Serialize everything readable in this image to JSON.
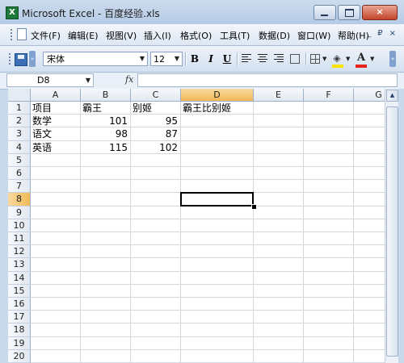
{
  "window": {
    "title": "Microsoft Excel - 百度经验.xls",
    "app_icon": "X",
    "controls": {
      "minimize": "minimize-icon",
      "maximize": "maximize-icon",
      "close": "×"
    }
  },
  "menu": {
    "items": [
      "文件(F)",
      "编辑(E)",
      "视图(V)",
      "插入(I)",
      "格式(O)",
      "工具(T)",
      "数据(D)",
      "窗口(W)",
      "帮助(H)"
    ],
    "doc_controls": [
      "_",
      "₽",
      "×"
    ]
  },
  "toolbar": {
    "font_name": "宋体",
    "font_size": "12",
    "bold": "B",
    "italic": "I",
    "underline": "U",
    "font_color_letter": "A",
    "fill_color": "#f7e200",
    "font_color": "#e8221c"
  },
  "formula_bar": {
    "name_box": "D8",
    "fx_label": "fx",
    "formula": ""
  },
  "sheet": {
    "columns": [
      "A",
      "B",
      "C",
      "D",
      "E",
      "F",
      "G"
    ],
    "rows": [
      "1",
      "2",
      "3",
      "4",
      "5",
      "6",
      "7",
      "8",
      "9",
      "10",
      "11",
      "12",
      "13",
      "14",
      "15",
      "16",
      "17",
      "18",
      "19",
      "20"
    ],
    "active_cell": "D8",
    "cells": [
      {
        "ref": "A1",
        "value": "项目"
      },
      {
        "ref": "B1",
        "value": "霸王"
      },
      {
        "ref": "C1",
        "value": "别姬"
      },
      {
        "ref": "D1",
        "value": "霸王比别姬"
      },
      {
        "ref": "A2",
        "value": "数学"
      },
      {
        "ref": "B2",
        "value": "101"
      },
      {
        "ref": "C2",
        "value": "95"
      },
      {
        "ref": "A3",
        "value": "语文"
      },
      {
        "ref": "B3",
        "value": "98"
      },
      {
        "ref": "C3",
        "value": "87"
      },
      {
        "ref": "A4",
        "value": "英语"
      },
      {
        "ref": "B4",
        "value": "115"
      },
      {
        "ref": "C4",
        "value": "102"
      }
    ]
  },
  "scrollbar": {
    "up": "▲",
    "down": "▼"
  }
}
